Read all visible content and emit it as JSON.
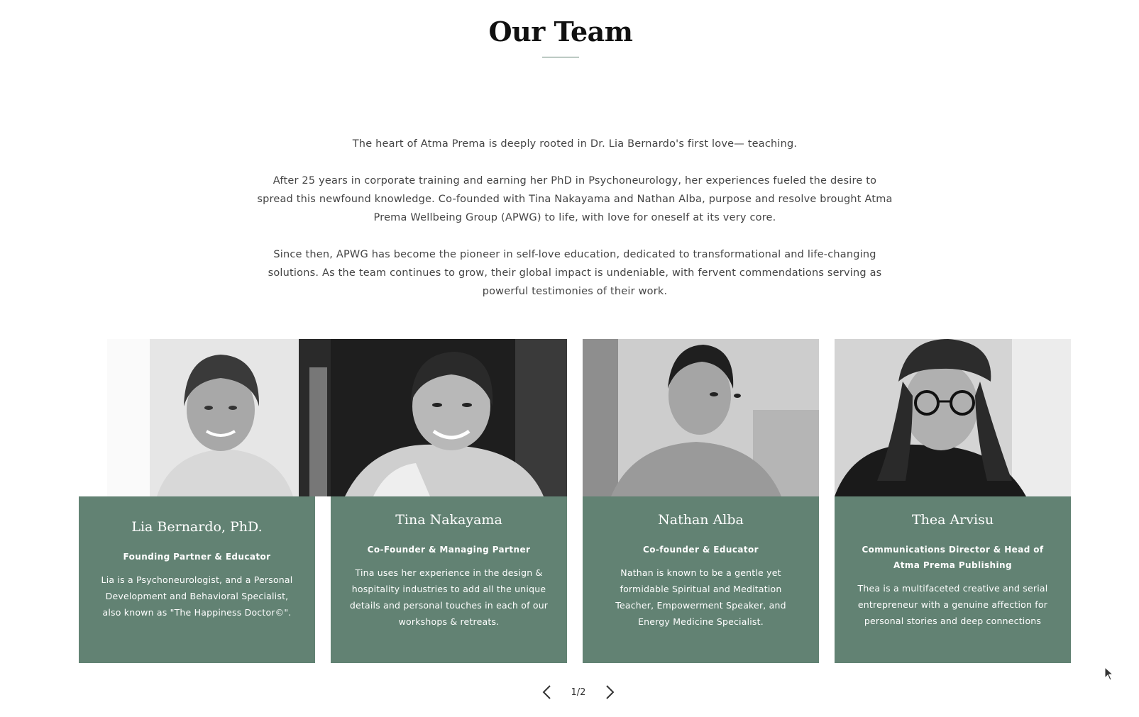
{
  "section": {
    "title": "Our Team"
  },
  "intro": {
    "paragraphs": [
      "The heart of Atma Prema is deeply rooted in Dr. Lia Bernardo's first love— teaching.",
      "After 25 years in corporate training and earning her PhD in Psychoneurology, her experiences fueled the desire to spread this newfound knowledge. Co-founded with Tina Nakayama and Nathan Alba, purpose and resolve brought Atma Prema Wellbeing Group (APWG) to life, with love for oneself at its very core.",
      "Since then, APWG has become the pioneer in self-love education, dedicated to transformational and life-changing solutions. As the team continues to grow, their global impact is undeniable, with fervent commendations serving as powerful testimonies of their work."
    ]
  },
  "team": [
    {
      "name": "Lia Bernardo, PhD.",
      "role": "Founding Partner & Educator",
      "bio": "Lia is a Psychoneurologist, and a Personal Development and Behavioral Specialist, also known as \"The Happiness Doctor©\"."
    },
    {
      "name": "Tina Nakayama",
      "role": "Co-Founder & Managing Partner",
      "bio": "Tina uses her experience in the design & hospitality industries to add all the unique details and personal touches in each of our workshops & retreats."
    },
    {
      "name": "Nathan Alba",
      "role": "Co-founder & Educator",
      "bio": "Nathan is known to be a gentle yet formidable Spiritual and Meditation Teacher, Empowerment Speaker, and Energy Medicine Specialist."
    },
    {
      "name": "Thea Arvisu",
      "role": "Communications Director & Head of Atma Prema Publishing",
      "bio": "Thea is a multifaceted creative and serial entrepreneur with a genuine affection for personal stories and deep connections"
    }
  ],
  "pager": {
    "indicator": "1/2",
    "prev_icon": "chevron-left-icon",
    "next_icon": "chevron-right-icon"
  },
  "colors": {
    "card_panel": "#628273",
    "rule": "#5f7f70"
  }
}
